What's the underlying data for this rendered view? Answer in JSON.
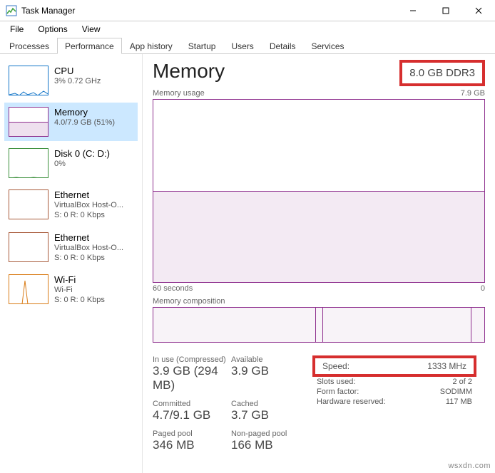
{
  "window": {
    "title": "Task Manager"
  },
  "menu": {
    "file": "File",
    "options": "Options",
    "view": "View"
  },
  "tabs": {
    "processes": "Processes",
    "performance": "Performance",
    "app_history": "App history",
    "startup": "Startup",
    "users": "Users",
    "details": "Details",
    "services": "Services"
  },
  "sidebar": {
    "cpu": {
      "name": "CPU",
      "stat": "3% 0.72 GHz"
    },
    "memory": {
      "name": "Memory",
      "stat": "4.0/7.9 GB (51%)"
    },
    "disk": {
      "name": "Disk 0 (C: D:)",
      "stat": "0%"
    },
    "eth1": {
      "name": "Ethernet",
      "stat1": "VirtualBox Host-O...",
      "stat2": "S: 0 R: 0 Kbps"
    },
    "eth2": {
      "name": "Ethernet",
      "stat1": "VirtualBox Host-O...",
      "stat2": "S: 0 R: 0 Kbps"
    },
    "wifi": {
      "name": "Wi-Fi",
      "stat1": "Wi-Fi",
      "stat2": "S: 0 R: 0 Kbps"
    }
  },
  "main": {
    "title": "Memory",
    "capacity": "8.0 GB DDR3",
    "usage_label": "Memory usage",
    "usage_max": "7.9 GB",
    "axis_left": "60 seconds",
    "axis_right": "0",
    "composition_label": "Memory composition",
    "stats": {
      "inuse_label": "In use (Compressed)",
      "inuse_value": "3.9 GB (294 MB)",
      "available_label": "Available",
      "available_value": "3.9 GB",
      "committed_label": "Committed",
      "committed_value": "4.7/9.1 GB",
      "cached_label": "Cached",
      "cached_value": "3.7 GB",
      "paged_label": "Paged pool",
      "paged_value": "346 MB",
      "nonpaged_label": "Non-paged pool",
      "nonpaged_value": "166 MB"
    },
    "info": {
      "speed_label": "Speed:",
      "speed_value": "1333 MHz",
      "slots_label": "Slots used:",
      "slots_value": "2 of 2",
      "form_label": "Form factor:",
      "form_value": "SODIMM",
      "reserved_label": "Hardware reserved:",
      "reserved_value": "117 MB"
    }
  },
  "chart_data": {
    "type": "area",
    "title": "Memory usage",
    "ylabel": "GB",
    "ylim": [
      0,
      7.9
    ],
    "x_range_seconds": 60,
    "series": [
      {
        "name": "In use",
        "values": [
          4.0,
          4.0,
          4.0,
          4.0,
          4.0,
          4.0,
          4.0,
          4.0,
          4.0,
          4.0
        ]
      }
    ],
    "composition": {
      "total_gb": 7.9,
      "in_use_gb": 3.9,
      "compressed_gb": 0.29,
      "available_gb": 3.9
    }
  },
  "watermark": "wsxdn.com"
}
